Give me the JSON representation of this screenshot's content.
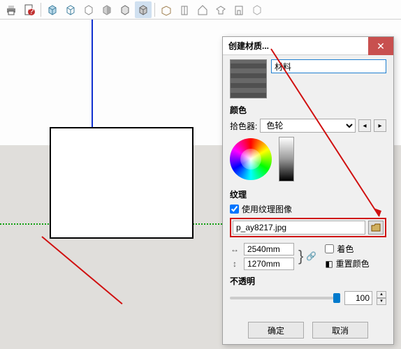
{
  "toolbar": {
    "icons": [
      "printer",
      "help-doc",
      "cube",
      "cube-wire",
      "cube-flat",
      "cylinder",
      "surface",
      "group",
      "box",
      "building",
      "house",
      "component",
      "window",
      "misc"
    ]
  },
  "dialog": {
    "title": "创建材质...",
    "name_value": "材料",
    "color_section": "颜色",
    "picker_label": "拾色器:",
    "picker_value": "色轮",
    "texture_section": "纹理",
    "use_texture_label": "使用纹理图像",
    "file_value": "p_ay8217.jpg",
    "width_value": "2540mm",
    "height_value": "1270mm",
    "colorize_label": "着色",
    "reset_color_label": "重置颜色",
    "opacity_section": "不透明",
    "opacity_value": "100",
    "ok_label": "确定",
    "cancel_label": "取消"
  }
}
